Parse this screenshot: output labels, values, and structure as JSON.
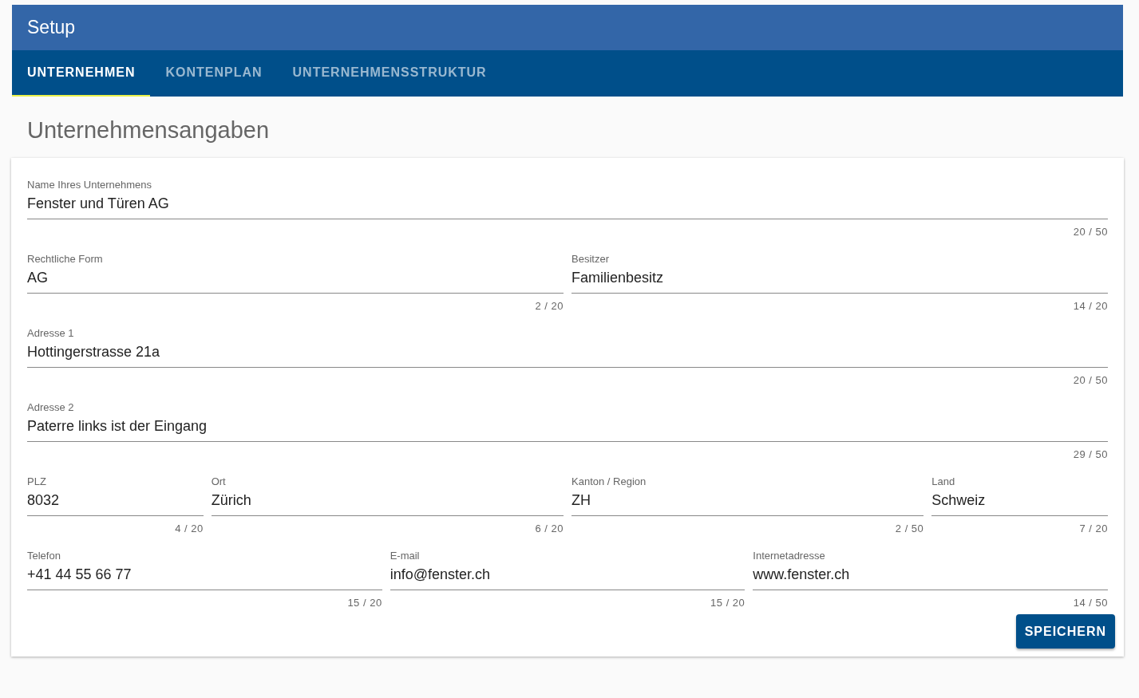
{
  "app_bar": {
    "title": "Setup"
  },
  "tabs": [
    {
      "label": "UNTERNEHMEN",
      "selected": true
    },
    {
      "label": "KONTENPLAN",
      "selected": false
    },
    {
      "label": "UNTERNEHMENSSTRUKTUR",
      "selected": false
    }
  ],
  "heading": "Unternehmensangaben",
  "form": {
    "rows": [
      {
        "kind": "full",
        "fields": [
          {
            "label": "Name Ihres Unternehmens",
            "value": "Fenster und Türen AG",
            "counter": "20 / 50"
          }
        ]
      },
      {
        "kind": "halves",
        "fields": [
          {
            "label": "Rechtliche Form",
            "value": "AG",
            "counter": "2 / 20"
          },
          {
            "label": "Besitzer",
            "value": "Familienbesitz",
            "counter": "14 / 20"
          }
        ]
      },
      {
        "kind": "full",
        "fields": [
          {
            "label": "Adresse 1",
            "value": "Hottingerstrasse 21a",
            "counter": "20 / 50"
          }
        ]
      },
      {
        "kind": "full",
        "fields": [
          {
            "label": "Adresse 2",
            "value": "Paterre links ist der Eingang",
            "counter": "29 / 50"
          }
        ]
      },
      {
        "kind": "address",
        "fields": [
          {
            "label": "PLZ",
            "value": "8032",
            "counter": "4 / 20"
          },
          {
            "label": "Ort",
            "value": "Zürich",
            "counter": "6 / 20"
          },
          {
            "label": "Kanton / Region",
            "value": "ZH",
            "counter": "2 / 50"
          },
          {
            "label": "Land",
            "value": "Schweiz",
            "counter": "7 / 20"
          }
        ]
      },
      {
        "kind": "thirds",
        "fields": [
          {
            "label": "Telefon",
            "value": "+41 44 55 66 77",
            "counter": "15 / 20"
          },
          {
            "label": "E-mail",
            "value": "info@fenster.ch",
            "counter": "15 / 20"
          },
          {
            "label": "Internetadresse",
            "value": "www.fenster.ch",
            "counter": "14 / 50"
          }
        ]
      }
    ],
    "save_button": "SPEICHERN"
  }
}
